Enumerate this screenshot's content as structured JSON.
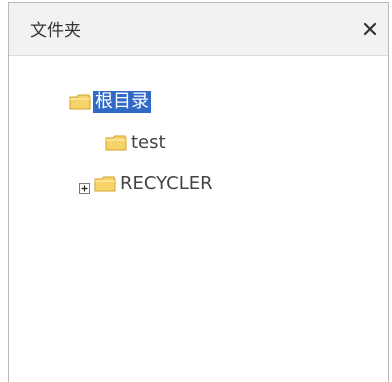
{
  "dialog": {
    "title": "文件夹",
    "close_glyph": "×"
  },
  "tree": {
    "nodes": [
      {
        "label": "根目录",
        "icon": "folder-icon",
        "selected": true
      },
      {
        "label": "test",
        "icon": "folder-icon",
        "selected": false
      },
      {
        "label": "RECYCLER",
        "icon": "folder-icon",
        "selected": false,
        "expander": "plus-box-icon"
      }
    ]
  },
  "colors": {
    "header_bg": "#f2f2f2",
    "selection_bg": "#316ac5",
    "folder_fill": "#f7d86a",
    "folder_stroke": "#d7a82e"
  }
}
